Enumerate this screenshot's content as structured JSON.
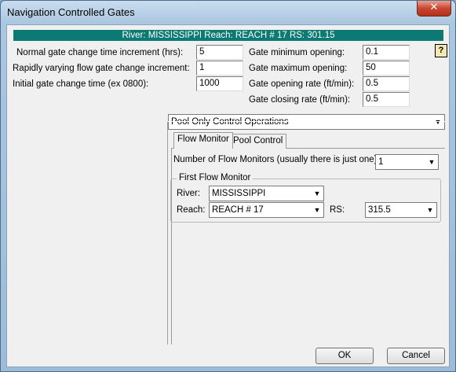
{
  "window": {
    "title": "Navigation Controlled Gates",
    "close_label": "✕"
  },
  "header": {
    "text": "River: MISSISSIPPI  Reach: REACH # 17  RS: 301.15"
  },
  "left_fields": [
    {
      "label": "Normal gate change time increment (hrs):",
      "value": "5"
    },
    {
      "label": "Rapidly varying flow gate change increment:",
      "value": "1"
    },
    {
      "label": "Initial gate change time (ex 0800):",
      "value": "1000"
    }
  ],
  "right_fields": [
    {
      "label": "Gate minimum opening:",
      "value": "0.1"
    },
    {
      "label": "Gate maximum opening:",
      "value": "50"
    },
    {
      "label": "Gate opening rate (ft/min):",
      "value": "0.5"
    },
    {
      "label": "Gate closing rate (ft/min):",
      "value": "0.5"
    }
  ],
  "help_label": "?",
  "operation_select": {
    "value": "Pool Only Control Operations"
  },
  "tabs": [
    {
      "label": "Flow Monitor"
    },
    {
      "label": "Pool Control"
    }
  ],
  "flow_monitor": {
    "count_label": "Number of Flow Monitors (usually there is just one):",
    "count_value": "1",
    "group_title": "First Flow Monitor",
    "river_label": "River:",
    "river_value": "MISSISSIPPI",
    "reach_label": "Reach:",
    "reach_value": "REACH # 17",
    "rs_label": "RS:",
    "rs_value": "315.5"
  },
  "buttons": {
    "ok": "OK",
    "cancel": "Cancel"
  },
  "icons": {
    "dropdown": "▼"
  }
}
